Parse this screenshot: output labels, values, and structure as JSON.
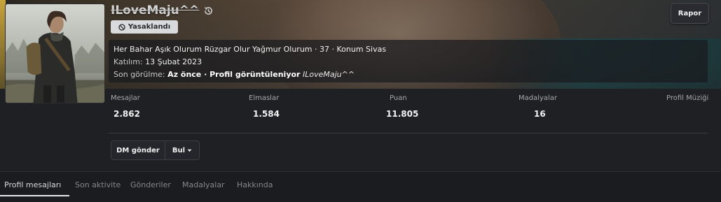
{
  "profile": {
    "username": "ILoveMaju^^",
    "banned_label": "Yasaklandı",
    "report_label": "Rapor",
    "info": {
      "line1": "Her Bahar Aşık Olurum Rüzgar Olur Yağmur Olurum · 37 · Konum Sivas",
      "joined_label": "Katılım:",
      "joined_value": "13 Şubat 2023",
      "lastseen_label": "Son görülme:",
      "lastseen_value": "Az önce · Profil görüntüleniyor",
      "lastseen_user": "ILoveMaju^^"
    }
  },
  "stats": [
    {
      "label": "Mesajlar",
      "value": "2.862"
    },
    {
      "label": "Elmaslar",
      "value": "1.584"
    },
    {
      "label": "Puan",
      "value": "11.805"
    },
    {
      "label": "Madalyalar",
      "value": "16"
    },
    {
      "label": "Profil Müziği",
      "value": ""
    }
  ],
  "actions": {
    "dm_label": "DM gönder",
    "find_label": "Bul"
  },
  "tabs": [
    {
      "label": "Profil mesajları",
      "active": true
    },
    {
      "label": "Son aktivite",
      "active": false
    },
    {
      "label": "Gönderiler",
      "active": false
    },
    {
      "label": "Madalyalar",
      "active": false
    },
    {
      "label": "Hakkında",
      "active": false
    }
  ],
  "colors": {
    "background": "#1f2024",
    "badge": "#d9dadc",
    "tab_active": "#d8d8d8",
    "tab_inactive": "#86878b"
  }
}
